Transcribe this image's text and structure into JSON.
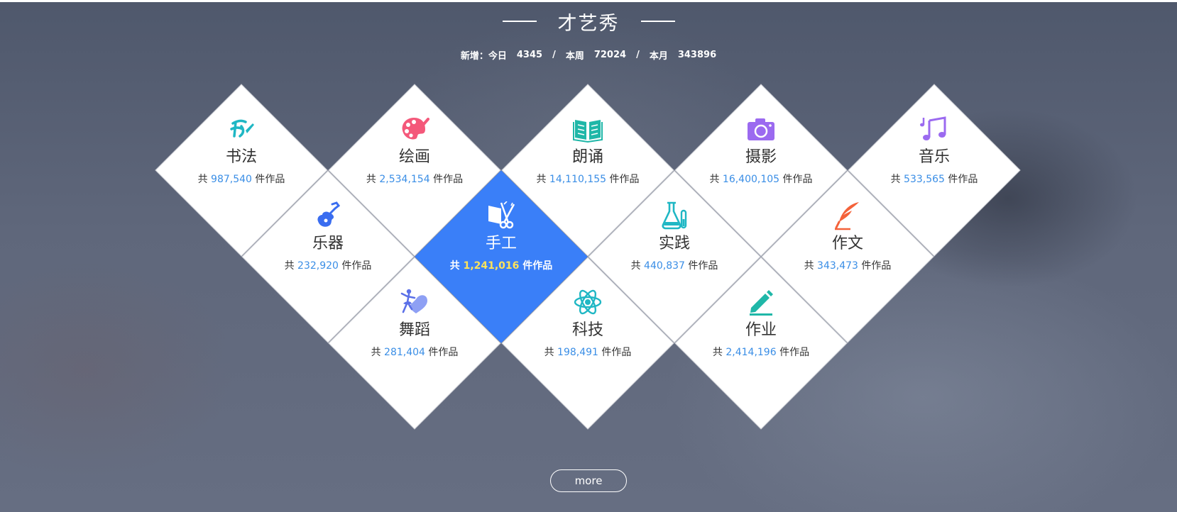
{
  "header": {
    "title": "才艺秀",
    "stats": {
      "new_label": "新增：",
      "today_label": "今日",
      "today_value": "4345",
      "week_label": "本周",
      "week_value": "72024",
      "month_label": "本月",
      "month_value": "343896",
      "separator": "/"
    }
  },
  "count_prefix": "共",
  "count_suffix": "件作品",
  "categories": [
    {
      "name": "书法",
      "count": "987,540",
      "icon": "calligraphy-icon",
      "color": "#1fb7c4"
    },
    {
      "name": "绘画",
      "count": "2,534,154",
      "icon": "palette-icon",
      "color": "#f4587a"
    },
    {
      "name": "朗诵",
      "count": "14,110,155",
      "icon": "book-icon",
      "color": "#1fb7a8"
    },
    {
      "name": "摄影",
      "count": "16,400,105",
      "icon": "camera-icon",
      "color": "#9b6af0"
    },
    {
      "name": "音乐",
      "count": "533,565",
      "icon": "music-note-icon",
      "color": "#9b6af0"
    },
    {
      "name": "乐器",
      "count": "232,920",
      "icon": "guitar-icon",
      "color": "#3a6df0"
    },
    {
      "name": "手工",
      "count": "1,241,016",
      "icon": "scissors-icon",
      "color": "#ffffff"
    },
    {
      "name": "实践",
      "count": "440,837",
      "icon": "flask-icon",
      "color": "#1fb7c4"
    },
    {
      "name": "作文",
      "count": "343,473",
      "icon": "quill-icon",
      "color": "#f4623a"
    },
    {
      "name": "舞蹈",
      "count": "281,404",
      "icon": "dancer-icon",
      "color": "#7b8cf0"
    },
    {
      "name": "科技",
      "count": "198,491",
      "icon": "atom-icon",
      "color": "#1fb7c4"
    },
    {
      "name": "作业",
      "count": "2,414,196",
      "icon": "pen-icon",
      "color": "#1fb7a8"
    }
  ],
  "active_category": "手工",
  "more_label": "more",
  "colors": {
    "accent": "#3a7ff8",
    "count_number": "#3a8ee6",
    "active_count_number": "#ffe35a"
  }
}
